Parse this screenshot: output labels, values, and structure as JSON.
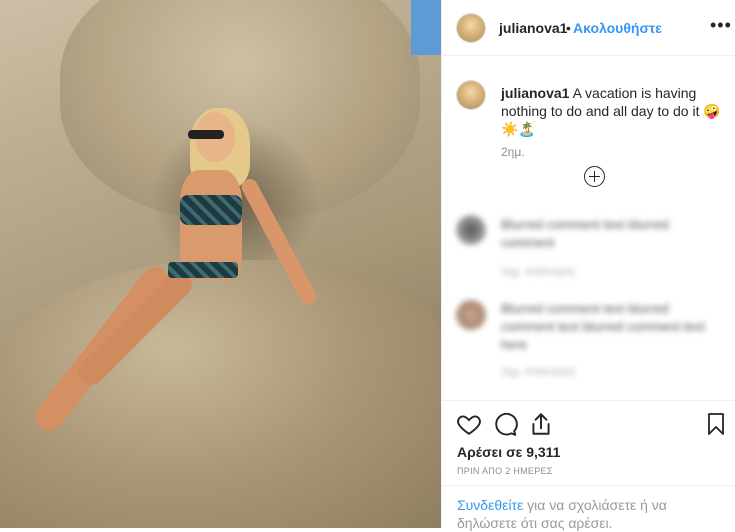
{
  "post": {
    "username": "julianova1",
    "separator": "•",
    "follow_label": "Ακολουθήστε",
    "more_icon": "more-horizontal-icon",
    "caption_text": "A vacation is having nothing to do and all day to do it 🤪☀️🏝️",
    "caption_time": "2ημ.",
    "load_more_icon": "plus-circle-icon"
  },
  "comments": [
    {
      "text": "Blurred comment text blurred comment",
      "meta": "2ημ.  Απάντηση"
    },
    {
      "text": "Blurred comment text blurred comment text blurred comment text here",
      "meta": "2ημ.  Απάντηση"
    }
  ],
  "actions": {
    "like_icon": "heart-icon",
    "comment_icon": "comment-icon",
    "share_icon": "share-icon",
    "save_icon": "bookmark-icon",
    "likes_text": "Αρέσει σε 9,311",
    "time_ago": "ΠΡΙΝ ΑΠΟ 2 ΗΜΕΡΕΣ",
    "login_link": "Συνδεθείτε",
    "login_rest": " για να σχολιάσετε ή να δηλώσετε ότι σας αρέσει."
  },
  "colors": {
    "link": "#3897f0",
    "text": "#262626",
    "muted": "#8e8e8e"
  }
}
